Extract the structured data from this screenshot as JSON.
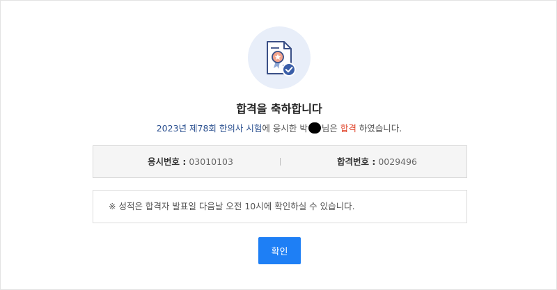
{
  "header": {
    "icon": "certificate-check-icon",
    "title": "합격을 축하합니다"
  },
  "message": {
    "exam": "2023년 제78회 한의사 시험",
    "mid": "에 응시한 ",
    "name_visible": "박",
    "after_name": "님은 ",
    "status": "합격",
    "tail": " 하였습니다."
  },
  "info": {
    "exam_number_label": "응시번호 :",
    "exam_number_value": " 03010103",
    "pass_number_label": "합격번호 :",
    "pass_number_value": " 0029496"
  },
  "notice": {
    "text": "※ 성적은 합격자 발표일 다음날 오전 10시에 확인하실 수 있습니다."
  },
  "actions": {
    "confirm_label": "확인"
  },
  "colors": {
    "accent": "#1e7ff5",
    "exam_text": "#2a4f8f",
    "pass_text": "#e0452b",
    "badge_bg": "#e8eef9"
  }
}
